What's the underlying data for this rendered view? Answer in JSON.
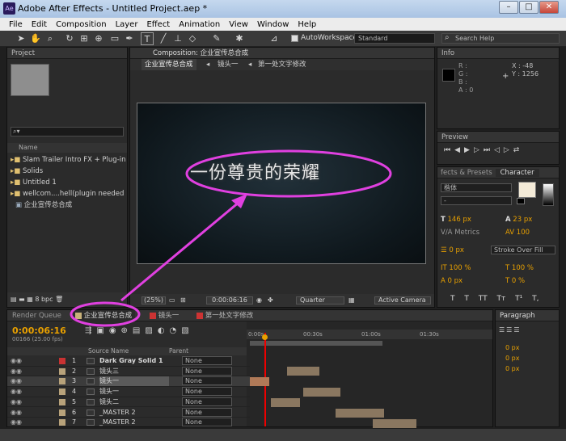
{
  "app": {
    "title": "Adobe After Effects - Untitled Project.aep *",
    "icon": "Ae"
  },
  "menu": [
    "File",
    "Edit",
    "Composition",
    "Layer",
    "Effect",
    "Animation",
    "View",
    "Window",
    "Help"
  ],
  "toolbar": {
    "autoworkspace": "AutoWorkspace:",
    "workspace": "Standard",
    "search_placeholder": "Search Help"
  },
  "project": {
    "tab": "Project",
    "col_name": "Name",
    "items": [
      "Slam Trailer Intro FX + Plug-in",
      "Solids",
      "Untitled 1",
      "wellcom....hell(plugin needed",
      "企业宣传总合成"
    ],
    "bpc": "8 bpc"
  },
  "comp": {
    "tab": "Composition: 企业宣传总合成",
    "breadcrumbs": [
      "企业宣传总合成",
      "镜头一",
      "第一处文字修改"
    ],
    "overlay_text": "一份尊贵的荣耀",
    "zoom": "(25%)",
    "time": "0:00:06:16",
    "quality": "Quarter",
    "camera": "Active Camera"
  },
  "info": {
    "tab": "Info",
    "labels": [
      "R :",
      "G :",
      "B :",
      "A : 0"
    ],
    "x": "X : -48",
    "y": "Y : 1256"
  },
  "preview": {
    "tab": "Preview"
  },
  "effects": {
    "tab": "fects & Presets"
  },
  "character": {
    "tab": "Character",
    "font": "楷体",
    "style": "-",
    "size": "146 px",
    "leading": "23 px",
    "kerning": "Metrics",
    "tracking": "100",
    "stroke": "0 px",
    "stroke_type": "Stroke Over Fill",
    "vscale": "100 %",
    "hscale": "100 %",
    "baseline": "0 px",
    "tsume": "0 %",
    "text_styles": [
      "T",
      "T",
      "TT",
      "Tт",
      "T¹",
      "T,"
    ]
  },
  "paragraph": {
    "tab": "Paragraph",
    "values": [
      "0 px",
      "0 px",
      "0 px"
    ]
  },
  "timeline": {
    "tabs": [
      "Render Queue",
      "企业宣传总合成",
      "镜头一",
      "第一处文字修改"
    ],
    "tab_colors": [
      "#555555",
      "#c8b27a",
      "#cc3333",
      "#cc3333"
    ],
    "current_time": "0:00:06:16",
    "fps": "00166 (25.00 fps)",
    "col_source": "Source Name",
    "col_parent": "Parent",
    "ruler": [
      "0:00s",
      "00:30s",
      "01:00s",
      "01:30s"
    ],
    "layers": [
      {
        "num": "1",
        "name": "Dark Gray Solid 1",
        "parent": "None",
        "color": "#c83232"
      },
      {
        "num": "2",
        "name": "镜头三",
        "parent": "None",
        "color": "#b8a27a"
      },
      {
        "num": "3",
        "name": "镜头一",
        "parent": "None",
        "color": "#b8a27a"
      },
      {
        "num": "4",
        "name": "镜头一",
        "parent": "None",
        "color": "#b8a27a"
      },
      {
        "num": "5",
        "name": "镜头二",
        "parent": "None",
        "color": "#b8a27a"
      },
      {
        "num": "6",
        "name": "_MASTER 2",
        "parent": "None",
        "color": "#b8a27a"
      },
      {
        "num": "7",
        "name": "_MASTER 2",
        "parent": "None",
        "color": "#b8a27a"
      }
    ]
  },
  "colors": {
    "accent": "#e8a000",
    "annotation": "#e040e0"
  }
}
